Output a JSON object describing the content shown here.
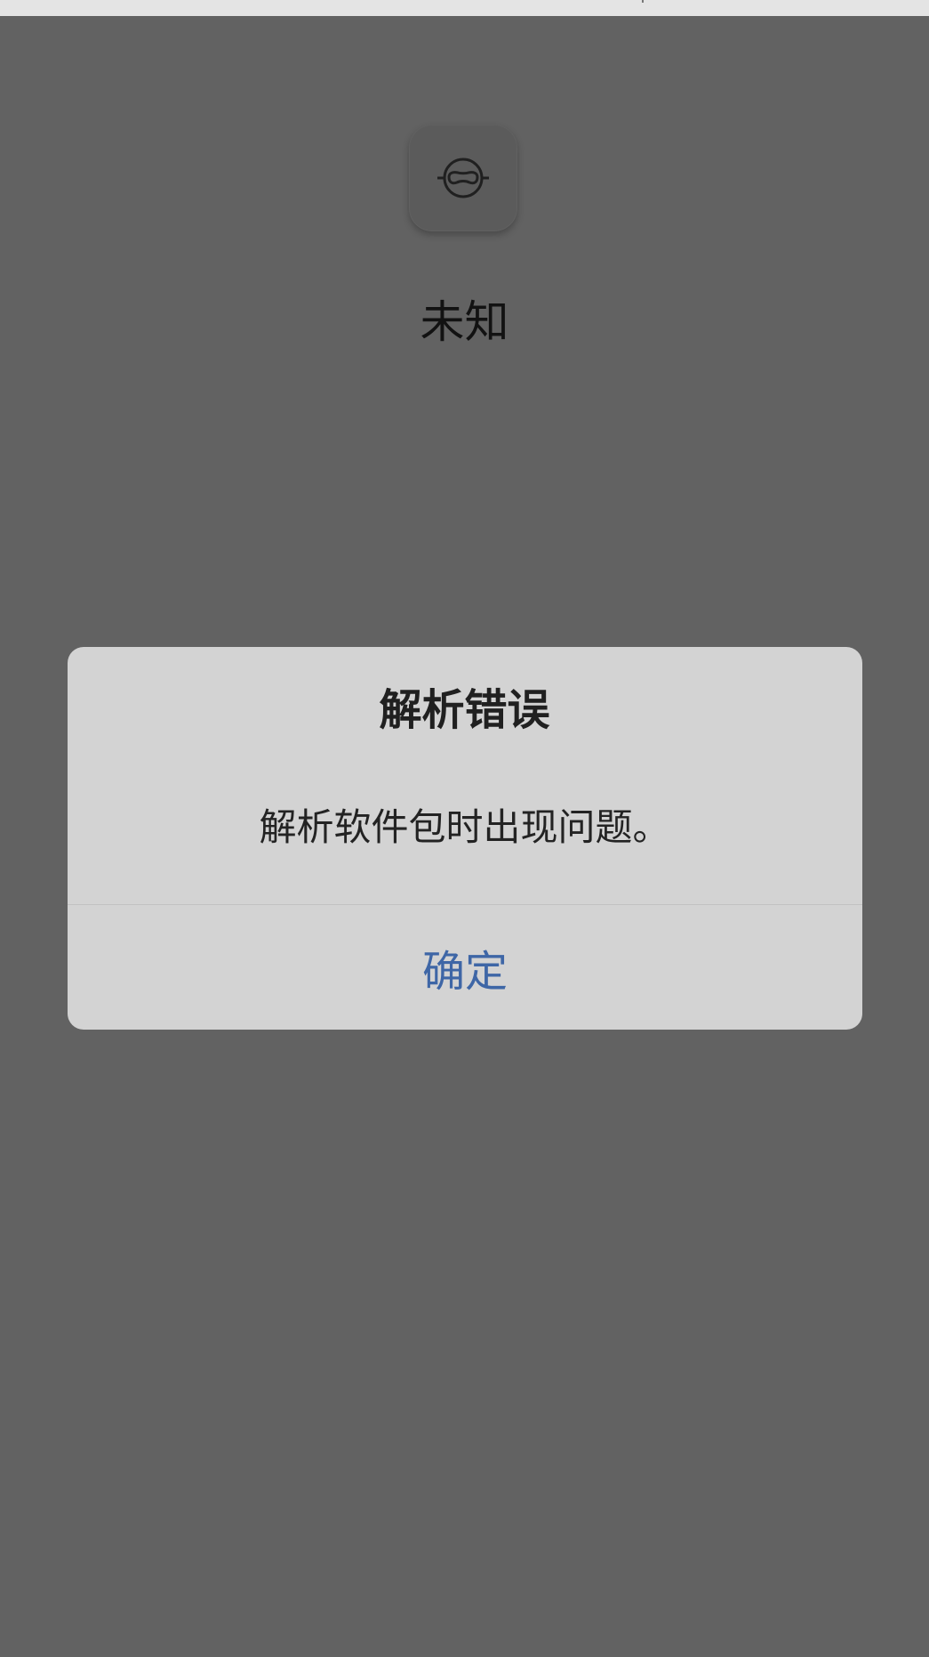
{
  "app": {
    "name": "未知",
    "icon": "unknown-app-icon"
  },
  "dialog": {
    "title": "解析错误",
    "message": "解析软件包时出现问题。",
    "confirm_label": "确定"
  },
  "colors": {
    "overlay_background": "#626262",
    "dialog_background": "#d3d3d3",
    "confirm_text": "#3e66a6"
  }
}
